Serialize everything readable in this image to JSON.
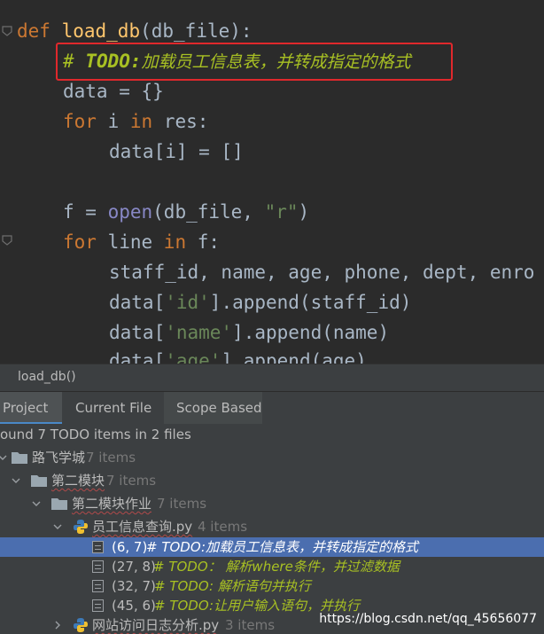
{
  "editor": {
    "line1": {
      "def": "def",
      "fn": "load_db",
      "params": "(db_file):"
    },
    "line2": {
      "hash": "# ",
      "todo": "TODO:",
      "text": "加载员工信息表，并转成指定的格式"
    },
    "line3": {
      "text": "data = {}"
    },
    "line4": {
      "for": "for",
      "mid": " i ",
      "in": "in",
      "rest": " res:"
    },
    "line5": {
      "text": "data[i] = []"
    },
    "line7": {
      "pre": "f = ",
      "open": "open",
      "mid": "(db_file, ",
      "str": "\"r\"",
      "end": ")"
    },
    "line8": {
      "for": "for",
      "mid": " line ",
      "in": "in",
      "rest": " f:"
    },
    "line9": {
      "text": "staff_id, name, age, phone, dept, enro"
    },
    "line10": {
      "pre": "data[",
      "str": "'id'",
      "post": "].append(staff_id)"
    },
    "line11": {
      "pre": "data[",
      "str": "'name'",
      "post": "].append(name)"
    },
    "line12": {
      "pre": "data[",
      "str": "'age'",
      "post": "].append(age)"
    }
  },
  "breadcrumb": "load_db()",
  "tabs": {
    "project": "Project",
    "current_file": "Current File",
    "scope_based": "Scope Based"
  },
  "tree": {
    "summary": "ound 7 TODO items in 2 files",
    "root": {
      "label": "路飞学城",
      "count": "7 items"
    },
    "module": {
      "label": "第二模块",
      "count": "7 items"
    },
    "homework": {
      "label": "第二模块作业",
      "count": "7 items"
    },
    "file1": {
      "label": "员工信息查询.py",
      "count": "4 items"
    },
    "items": [
      {
        "pos": "(6, 7)",
        "text": "# TODO:加载员工信息表，并转成指定的格式"
      },
      {
        "pos": "(27, 8)",
        "text": "# TODO：  解析where条件，并过滤数据"
      },
      {
        "pos": "(32, 7)",
        "text": "# TODO:  解析语句并执行"
      },
      {
        "pos": "(45, 6)",
        "text": "# TODO:让用户输入语句，并执行"
      }
    ],
    "file2": {
      "label": "网站访问日志分析.py",
      "count": "3 items"
    }
  },
  "watermark": "https://blog.csdn.net/qq_45656077",
  "colors": {
    "keyword": "#cc7832",
    "function": "#ffc66d",
    "string": "#6a8759",
    "todo": "#a8c023",
    "selection": "#4b6eaf",
    "highlight_box": "#e0282c"
  }
}
